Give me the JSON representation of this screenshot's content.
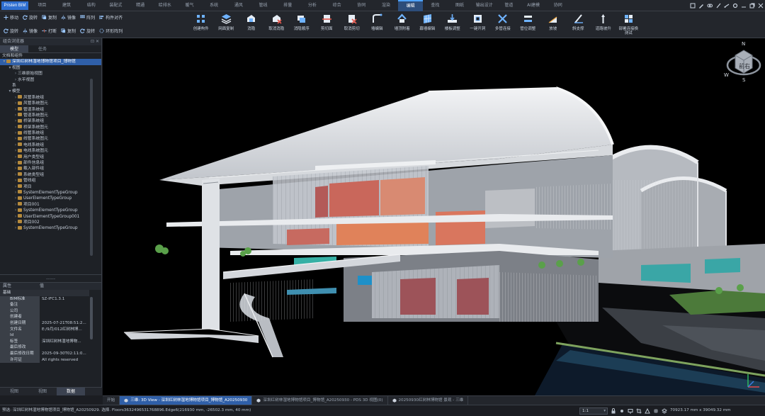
{
  "app": {
    "logo": "Pristen BIM"
  },
  "menu": {
    "tabs": [
      "项目",
      "建筑",
      "结构",
      "装配式",
      "精通",
      "给排水",
      "暖气",
      "系统",
      "通风",
      "管线",
      "排量",
      "分析",
      "综合",
      "协同",
      "渲染",
      "编辑",
      "查找",
      "图纸",
      "输出设计",
      "管道",
      "AI建模",
      "协同"
    ],
    "active_index": 15
  },
  "ribbon": {
    "row1": [
      {
        "label": "移动",
        "icon": "move-icon"
      },
      {
        "label": "旋转",
        "icon": "rotate-icon"
      },
      {
        "label": "复制",
        "icon": "copy-icon"
      },
      {
        "label": "镜像",
        "icon": "mirror-icon"
      },
      {
        "label": "阵列",
        "icon": "array-icon"
      },
      {
        "label": "构件对齐",
        "icon": "align-icon"
      }
    ],
    "row2": [
      {
        "label": "旋转",
        "icon": "rotate-icon"
      },
      {
        "label": "镜像",
        "icon": "mirror-icon"
      },
      {
        "label": "打断",
        "icon": "break-icon"
      },
      {
        "label": "复制",
        "icon": "copy-icon"
      },
      {
        "label": "旋转",
        "icon": "rotate-icon"
      },
      {
        "label": "环形阵列",
        "icon": "ring-array-icon"
      }
    ],
    "big": [
      {
        "label": "创建构件",
        "icon": "grid-icon"
      },
      {
        "label": "网面复制",
        "icon": "layers-icon"
      },
      {
        "label": "消隐",
        "icon": "hide-icon"
      },
      {
        "label": "取消消隐",
        "icon": "unhide-icon"
      },
      {
        "label": "消隐顺序",
        "icon": "order-icon"
      },
      {
        "label": "剪切面",
        "icon": "cut-icon"
      },
      {
        "label": "取消剪切",
        "icon": "uncut-icon"
      },
      {
        "label": "墙编辑",
        "icon": "wall-edit-icon"
      },
      {
        "label": "墙顶附着",
        "icon": "wall-top-icon"
      },
      {
        "label": "幕墙编辑",
        "icon": "curtain-wall-icon"
      },
      {
        "label": "楼板调整",
        "icon": "slab-icon"
      },
      {
        "label": "一键开洞",
        "icon": "opening-icon"
      },
      {
        "label": "多管连接",
        "icon": "pipe-connect-icon"
      },
      {
        "label": "管位调整",
        "icon": "pipe-adjust-icon"
      },
      {
        "label": "放坡",
        "icon": "slope-icon"
      },
      {
        "label": "斜支撑",
        "icon": "brace-icon"
      },
      {
        "label": "道路坡升",
        "icon": "road-icon"
      },
      {
        "label": "部署连接换测试",
        "icon": "deploy-icon"
      }
    ]
  },
  "left_panel": {
    "title": "组合浏览器",
    "tabs": [
      "模型",
      "任务"
    ],
    "active_tab": 0,
    "section_label": "文档和组件",
    "tree": [
      {
        "level": 0,
        "arrow": "▾",
        "folder": true,
        "label": "深圳红树林湿地博物馆项目_博物馆",
        "selected": true
      },
      {
        "level": 1,
        "arrow": "▾",
        "folder": false,
        "label": "视图"
      },
      {
        "level": 2,
        "arrow": "›",
        "folder": false,
        "label": "三维原始视图"
      },
      {
        "level": 2,
        "arrow": "›",
        "folder": false,
        "label": "水平视图"
      },
      {
        "level": 1,
        "arrow": "",
        "folder": false,
        "label": "系"
      },
      {
        "level": 1,
        "arrow": "▾",
        "folder": false,
        "label": "模型"
      },
      {
        "level": 2,
        "arrow": "›",
        "folder": true,
        "label": "风管系统组"
      },
      {
        "level": 2,
        "arrow": "›",
        "folder": true,
        "label": "风管系统图元"
      },
      {
        "level": 2,
        "arrow": "›",
        "folder": true,
        "label": "管道系统组"
      },
      {
        "level": 2,
        "arrow": "›",
        "folder": true,
        "label": "管道系统图元"
      },
      {
        "level": 2,
        "arrow": "›",
        "folder": true,
        "label": "桥架系统组"
      },
      {
        "level": 2,
        "arrow": "›",
        "folder": true,
        "label": "桥架系统图元"
      },
      {
        "level": 2,
        "arrow": "›",
        "folder": true,
        "label": "线管系统组"
      },
      {
        "level": 2,
        "arrow": "›",
        "folder": true,
        "label": "线管系统图元"
      },
      {
        "level": 2,
        "arrow": "›",
        "folder": true,
        "label": "电线系统组"
      },
      {
        "level": 2,
        "arrow": "›",
        "folder": true,
        "label": "电线系统图元"
      },
      {
        "level": 2,
        "arrow": "›",
        "folder": true,
        "label": "用户类型组"
      },
      {
        "level": 2,
        "arrow": "›",
        "folder": true,
        "label": "部件信息组"
      },
      {
        "level": 2,
        "arrow": "›",
        "folder": true,
        "label": "载入部件组"
      },
      {
        "level": 2,
        "arrow": "›",
        "folder": true,
        "label": "系统类型组"
      },
      {
        "level": 2,
        "arrow": "›",
        "folder": true,
        "label": "管线组"
      },
      {
        "level": 2,
        "arrow": "›",
        "folder": true,
        "label": "项目"
      },
      {
        "level": 2,
        "arrow": "›",
        "folder": true,
        "label": "SystemElementTypeGroup"
      },
      {
        "level": 2,
        "arrow": "›",
        "folder": true,
        "label": "UserElementTypeGroup"
      },
      {
        "level": 2,
        "arrow": "›",
        "folder": true,
        "label": "项目001"
      },
      {
        "level": 2,
        "arrow": "›",
        "folder": true,
        "label": "SystemElementTypeGroup"
      },
      {
        "level": 2,
        "arrow": "›",
        "folder": true,
        "label": "UserElementTypeGroup001"
      },
      {
        "level": 2,
        "arrow": "›",
        "folder": true,
        "label": "项目002"
      },
      {
        "level": 2,
        "arrow": "›",
        "folder": true,
        "label": "SystemElementTypeGroup"
      }
    ],
    "divider": "------",
    "props_header": [
      "属性",
      "值"
    ],
    "props": [
      {
        "group": true,
        "k": "基础",
        "v": ""
      },
      {
        "k": "BIM标准",
        "v": "SZ-IFC1.3.1"
      },
      {
        "k": "备注",
        "v": ""
      },
      {
        "k": "公司",
        "v": ""
      },
      {
        "k": "创建者",
        "v": ""
      },
      {
        "k": "创建日期",
        "v": "2025-07-21T08:51:2..."
      },
      {
        "k": "文件名",
        "v": "E:/9月/012红树林博..."
      },
      {
        "k": "Id",
        "v": ""
      },
      {
        "k": "标签",
        "v": "深圳红树林湿地博物..."
      },
      {
        "k": "最后修改",
        "v": ""
      },
      {
        "k": "最后修改日期",
        "v": "2025-09-30T02:11:0..."
      },
      {
        "k": "许可证",
        "v": "All rights reserved"
      }
    ],
    "bottom_tabs": [
      "视图",
      "视图",
      "数据"
    ],
    "bottom_active": 2
  },
  "viewcube": {
    "face": "前右",
    "compass_n": "N",
    "compass_w": "W",
    "compass_s": "S"
  },
  "doc_tabs": [
    {
      "label": "开始",
      "active": false
    },
    {
      "label": "三维: 3D View - 深圳红树林湿地博物馆项目_博物馆_A20250930",
      "active": true
    },
    {
      "label": "深圳红树林湿地博物馆项目_博物馆_A20250930 - PDS 3D 视图(0)",
      "active": false
    },
    {
      "label": "20250930红树林博物馆 景观 - 三维",
      "active": false
    }
  ],
  "status": {
    "text": "预选: 深圳红树林湿地博物馆项目_博物馆_A20250929. 选择. Floors3632496531768896.Edge6(216930 mm, -26502.3 mm, 40 mm)",
    "zoom": "1:1",
    "coords": "70923.17 mm x 39049.32 mm"
  }
}
